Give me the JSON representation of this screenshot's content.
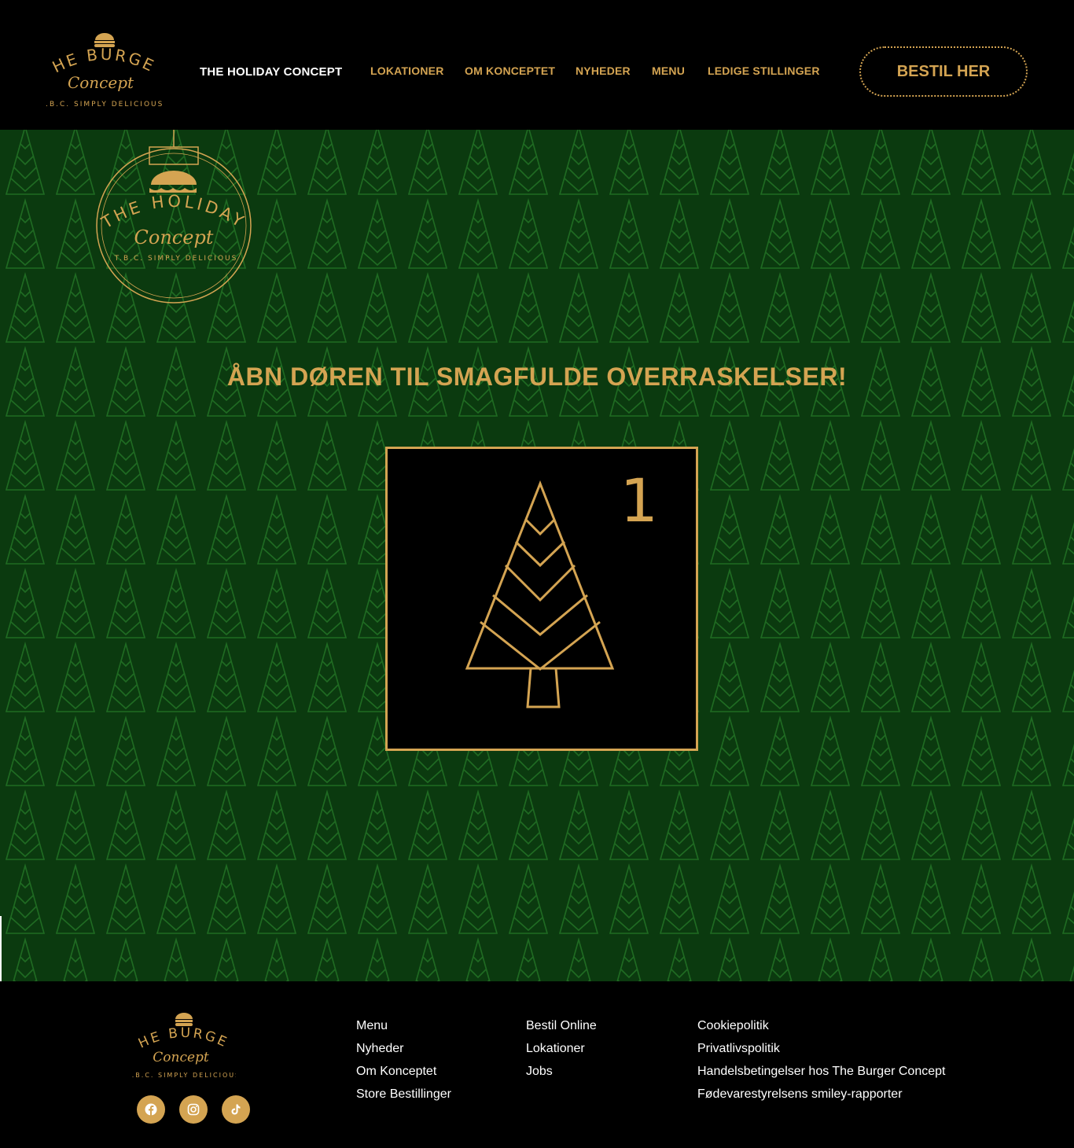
{
  "header": {
    "logo": {
      "line1": "THE BURGER",
      "line2": "Concept",
      "tagline": "T.B.C. SIMPLY DELICIOUS"
    },
    "nav": [
      {
        "label": "THE HOLIDAY CONCEPT",
        "active": true
      },
      {
        "label": "LOKATIONER"
      },
      {
        "label": "OM KONCEPTET"
      },
      {
        "label": "NYHEDER"
      },
      {
        "label": "MENU"
      },
      {
        "label": "LEDIGE STILLINGER"
      }
    ],
    "order_button": "BESTIL HER"
  },
  "hero": {
    "logo": {
      "line1": "THE HOLIDAY",
      "line2": "Concept",
      "tagline": "T.B.C. SIMPLY DELICIOUS"
    },
    "title": "ÅBN DØREN TIL SMAGFULDE OVERRASKELSER!",
    "door": {
      "number": "1"
    }
  },
  "footer": {
    "logo": {
      "line1": "THE BURGER",
      "line2": "Concept",
      "tagline": "T.B.C. SIMPLY DELICIOUS"
    },
    "col1": [
      "Menu",
      "Nyheder",
      "Om Konceptet",
      "Store Bestillinger"
    ],
    "col2": [
      "Bestil Online",
      "Lokationer",
      "Jobs"
    ],
    "col3": [
      "Cookiepolitik",
      "Privatlivspolitik",
      "Handelsbetingelser hos The Burger Concept",
      "Fødevarestyrelsens smiley-rapporter"
    ],
    "social": [
      "facebook-icon",
      "instagram-icon",
      "tiktok-icon"
    ]
  },
  "colors": {
    "gold": "#d4a452",
    "green": "#0b3a0f",
    "black": "#000000"
  }
}
